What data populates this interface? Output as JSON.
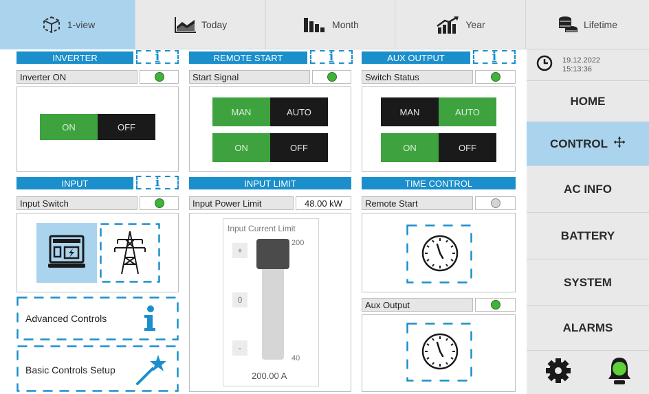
{
  "tabs": [
    {
      "label": "1-view",
      "icon": "device-icon",
      "active": true
    },
    {
      "label": "Today",
      "icon": "area-chart-icon",
      "active": false
    },
    {
      "label": "Month",
      "icon": "bar-chart-icon",
      "active": false
    },
    {
      "label": "Year",
      "icon": "growth-chart-icon",
      "active": false
    },
    {
      "label": "Lifetime",
      "icon": "coins-stack-icon",
      "active": false
    }
  ],
  "inverter": {
    "title": "INVERTER",
    "status_label": "Inverter ON",
    "on_label": "ON",
    "off_label": "OFF"
  },
  "remote_start": {
    "title": "REMOTE START",
    "status_label": "Start Signal",
    "man_label": "MAN",
    "auto_label": "AUTO",
    "on_label": "ON",
    "off_label": "OFF"
  },
  "aux_output": {
    "title": "AUX OUTPUT",
    "status_label": "Switch Status",
    "man_label": "MAN",
    "auto_label": "AUTO",
    "on_label": "ON",
    "off_label": "OFF"
  },
  "input": {
    "title": "INPUT",
    "status_label": "Input Switch"
  },
  "input_limit": {
    "title": "INPUT LIMIT",
    "power_label": "Input Power Limit",
    "power_value": "48.00 kW",
    "slider_title": "Input Current Limit",
    "plus_label": "+",
    "zero_label": "0",
    "minus_label": "-",
    "max_tick": "200",
    "min_tick": "40",
    "current_value": "200.00 A",
    "level": 1.0
  },
  "time_control": {
    "title": "TIME CONTROL",
    "remote_start_label": "Remote Start",
    "aux_output_label": "Aux Output"
  },
  "links": {
    "advanced": "Advanced Controls",
    "basic": "Basic Controls Setup"
  },
  "info_glyph": "i",
  "sidebar": {
    "date": "19.12.2022",
    "time": "15:13:36",
    "items": [
      {
        "label": "HOME",
        "active": false
      },
      {
        "label": "CONTROL",
        "active": true
      },
      {
        "label": "AC INFO",
        "active": false
      },
      {
        "label": "BATTERY",
        "active": false
      },
      {
        "label": "SYSTEM",
        "active": false
      },
      {
        "label": "ALARMS",
        "active": false
      }
    ]
  },
  "colors": {
    "accent_blue": "#1b8fcb",
    "active_bg": "#aad3ee",
    "green": "#3ea33e",
    "black": "#1a1a1a",
    "led_green": "#3db43b"
  }
}
